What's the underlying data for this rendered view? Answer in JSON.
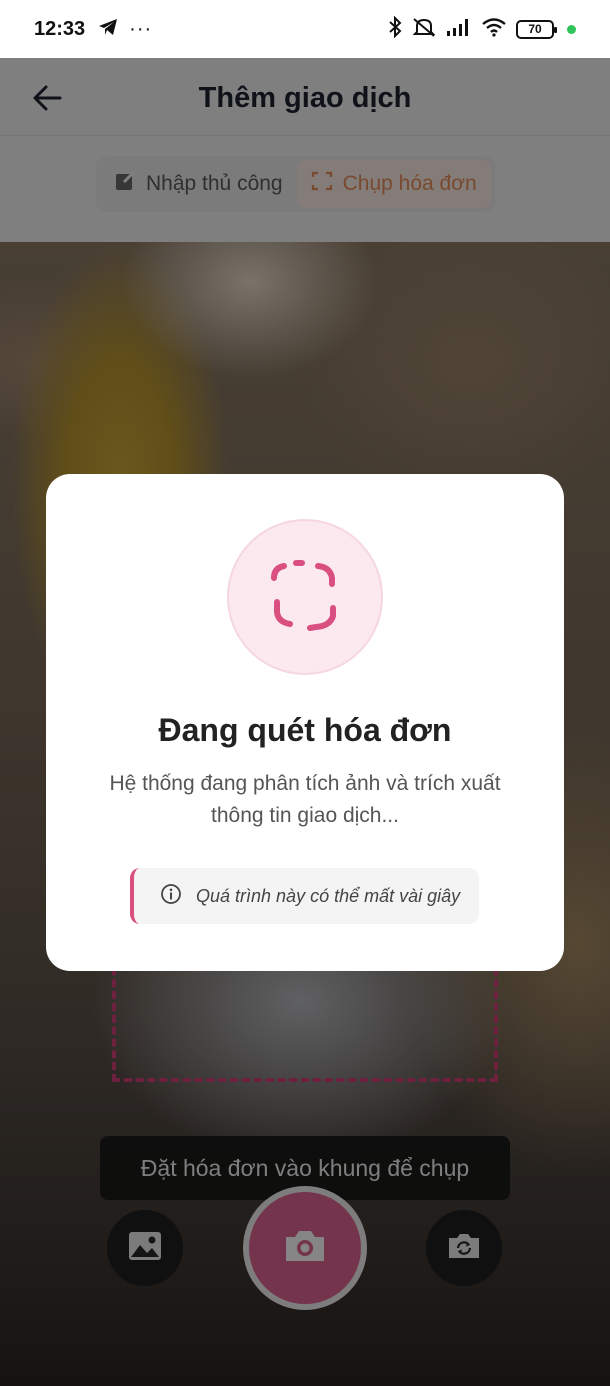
{
  "status_bar": {
    "time": "12:33",
    "dots": "···",
    "battery": "70",
    "icons": [
      "telegram-icon",
      "bluetooth-icon",
      "mute-icon",
      "signal-icon",
      "wifi-icon",
      "battery-icon"
    ]
  },
  "header": {
    "title": "Thêm giao dịch",
    "back_icon": "arrow-left-icon"
  },
  "mode_tabs": {
    "manual_label": "Nhập thủ công",
    "scan_label": "Chụp hóa đơn",
    "active": "scan"
  },
  "camera": {
    "hint": "Đặt hóa đơn vào khung để chụp"
  },
  "modal": {
    "title": "Đang quét hóa đơn",
    "description": "Hệ thống đang phân tích ảnh và trích xuất thông tin giao dịch...",
    "note": "Quá trình này có thể mất vài giây"
  },
  "colors": {
    "accent": "#d94f80",
    "scan_tab": "#e88e5a",
    "modal_bg": "#ffffff",
    "circle_bg": "#fbe9ef"
  }
}
